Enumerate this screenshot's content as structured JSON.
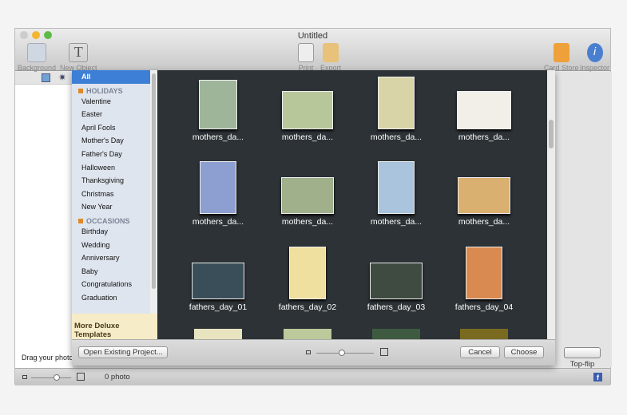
{
  "window": {
    "title": "Untitled"
  },
  "toolbar": {
    "background": "Background",
    "new_object": "New Object",
    "print": "Print",
    "export": "Export",
    "card_store": "Card Store",
    "inspector": "Inspector"
  },
  "sidebar": {
    "all": "All",
    "holidays_header": "HOLIDAYS",
    "holidays": [
      "Valentine",
      "Easter",
      "April Fools",
      "Mother's Day",
      "Father's Day",
      "Halloween",
      "Thanksgiving",
      "Christmas",
      "New Year"
    ],
    "occasions_header": "OCCASIONS",
    "occasions": [
      "Birthday",
      "Wedding",
      "Anniversary",
      "Baby",
      "Congratulations",
      "Graduation"
    ],
    "more": "More Deluxe Templates"
  },
  "templates": [
    {
      "label": "mothers_da...",
      "color": "#9fb59a"
    },
    {
      "label": "mothers_da...",
      "color": "#b7c79a"
    },
    {
      "label": "mothers_da...",
      "color": "#d9d3a8"
    },
    {
      "label": "mothers_da...",
      "color": "#f2efe9"
    },
    {
      "label": "mothers_da...",
      "color": "#8d9fd0"
    },
    {
      "label": "mothers_da...",
      "color": "#9fb08a"
    },
    {
      "label": "mothers_da...",
      "color": "#a9c4dc"
    },
    {
      "label": "mothers_da...",
      "color": "#d9b070"
    },
    {
      "label": "fathers_day_01",
      "color": "#3a4e5a"
    },
    {
      "label": "fathers_day_02",
      "color": "#f0e0a0"
    },
    {
      "label": "fathers_day_03",
      "color": "#3f4a40"
    },
    {
      "label": "fathers_day_04",
      "color": "#d98a50"
    }
  ],
  "sheet": {
    "open_existing": "Open Existing Project...",
    "cancel": "Cancel",
    "choose": "Choose"
  },
  "left": {
    "drag_hint": "Drag your photos"
  },
  "status": {
    "photo_count": "0 photo"
  },
  "right": {
    "layout_label": "Top-flip"
  },
  "colors": {
    "selection": "#3d7fd6",
    "grid_bg": "#2c3236"
  }
}
